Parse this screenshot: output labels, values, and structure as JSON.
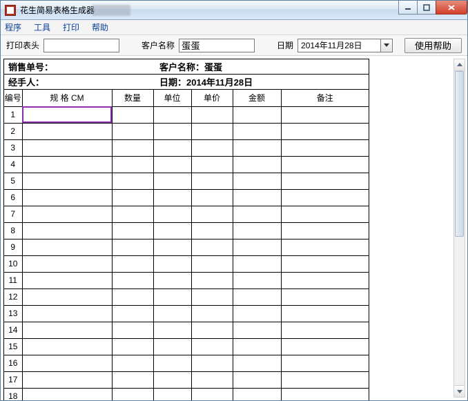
{
  "window": {
    "title": "花生简易表格生成器"
  },
  "menu": {
    "program": "程序",
    "tools": "工具",
    "print": "打印",
    "help": "帮助"
  },
  "toolbar": {
    "print_header_label": "打印表头",
    "print_header_value": "",
    "customer_label": "客户名称",
    "customer_value": "蛋蛋",
    "date_label": "日期",
    "date_value": "2014年11月28日",
    "help_button": "使用帮助"
  },
  "doc": {
    "sales_no_label": "销售单号：",
    "customer_label": "客户名称：蛋蛋",
    "handler_label": "经手人：",
    "date_label": "日期：2014年11月28日",
    "columns": {
      "idx": "编号",
      "spec": "规   格 CM",
      "qty": "数量",
      "unit": "单位",
      "uprice": "单价",
      "amount": "金额",
      "remark": "备注"
    },
    "rows": [
      "1",
      "2",
      "3",
      "4",
      "5",
      "6",
      "7",
      "8",
      "9",
      "10",
      "11",
      "12",
      "13",
      "14",
      "15",
      "16",
      "17",
      "18"
    ],
    "selected_row": 0
  }
}
